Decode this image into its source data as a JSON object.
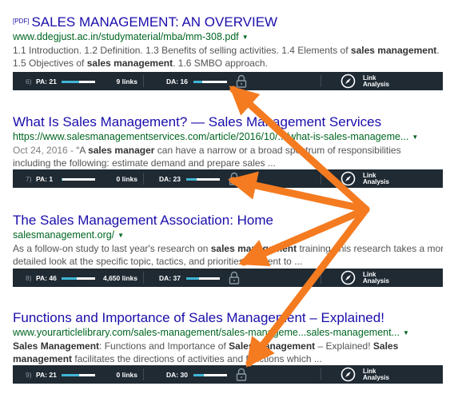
{
  "results": [
    {
      "pdf_tag": "[PDF]",
      "title": "SALES MANAGEMENT: AN OVERVIEW",
      "url": "www.ddegjust.ac.in/studymaterial/mba/mm-308.pdf",
      "snippet_line1": [
        {
          "t": "1.1 Introduction. 1.2 Definition. 1.3 Benefits of selling activities. 1.4 Elements of ",
          "b": false
        },
        {
          "t": "sales management",
          "b": true
        },
        {
          "t": ".",
          "b": false
        }
      ],
      "snippet_line2": [
        {
          "t": "1.5 Objectives of ",
          "b": false
        },
        {
          "t": "sales management",
          "b": true
        },
        {
          "t": ". 1.6 SMBO approach.",
          "b": false
        }
      ],
      "bar": {
        "index": "6)",
        "pa": "PA: 21",
        "pa_fill": 0.52,
        "links": "9 links",
        "da": "DA: 16",
        "da_fill": 0.25,
        "la1": "Link",
        "la2": "Analysis"
      }
    },
    {
      "title": "What Is Sales Management? — Sales Management Services",
      "url": "https://www.salesmanagementservices.com/article/2016/10/.../what-is-sales-manageme...",
      "date": "Oct 24, 2016 - ",
      "snippet_line1": [
        {
          "t": "“A ",
          "b": false
        },
        {
          "t": "sales manager",
          "b": true
        },
        {
          "t": " can have a narrow or a broad spectrum of responsibilities",
          "b": false
        }
      ],
      "snippet_line2": [
        {
          "t": "including the following: estimate demand and prepare sales ...",
          "b": false
        }
      ],
      "bar": {
        "index": "7)",
        "pa": "PA: 1",
        "pa_fill": 0.03,
        "links": "0 links",
        "da": "DA: 23",
        "da_fill": 0.3,
        "la1": "Link",
        "la2": "Analysis"
      }
    },
    {
      "title": "The Sales Management Association: Home",
      "url": "salesmanagement.org/",
      "snippet_line1": [
        {
          "t": "As a follow-on study to last year's research on ",
          "b": false
        },
        {
          "t": "sales management",
          "b": true
        },
        {
          "t": " training, this research takes a more",
          "b": false
        }
      ],
      "snippet_line2": [
        {
          "t": "detailed look at the specific topic, tactics, and priorities inherent to ...",
          "b": false
        }
      ],
      "bar": {
        "index": "8)",
        "pa": "PA: 46",
        "pa_fill": 0.45,
        "links": "4,650 links",
        "da": "DA: 37",
        "da_fill": 0.37,
        "la1": "Link",
        "la2": "Analysis"
      }
    },
    {
      "title": "Functions and Importance of Sales Management – Explained!",
      "url": "www.yourarticlelibrary.com/sales-management/sales-manageme...sales-management...",
      "snippet_line1": [
        {
          "t": "Sales Management",
          "b": true
        },
        {
          "t": ": Functions and Importance of ",
          "b": false
        },
        {
          "t": "Sales Management",
          "b": true
        },
        {
          "t": " – Explained! ",
          "b": false
        },
        {
          "t": "Sales",
          "b": true
        }
      ],
      "snippet_line2": [
        {
          "t": "management",
          "b": true
        },
        {
          "t": " facilitates the directions of activities and functions which ...",
          "b": false
        }
      ],
      "bar": {
        "index": "9)",
        "pa": "PA: 21",
        "pa_fill": 0.52,
        "links": "0 links",
        "da": "DA: 30",
        "da_fill": 0.3,
        "la1": "Link",
        "la2": "Analysis"
      }
    }
  ],
  "colors": {
    "title": "#1a0dab",
    "url": "#006621",
    "bar": "#1f2a33",
    "meter": "#40b6d6",
    "arrow": "#f47b20"
  },
  "icons": [
    "lock-icon",
    "compass-icon",
    "caret-down-icon"
  ]
}
